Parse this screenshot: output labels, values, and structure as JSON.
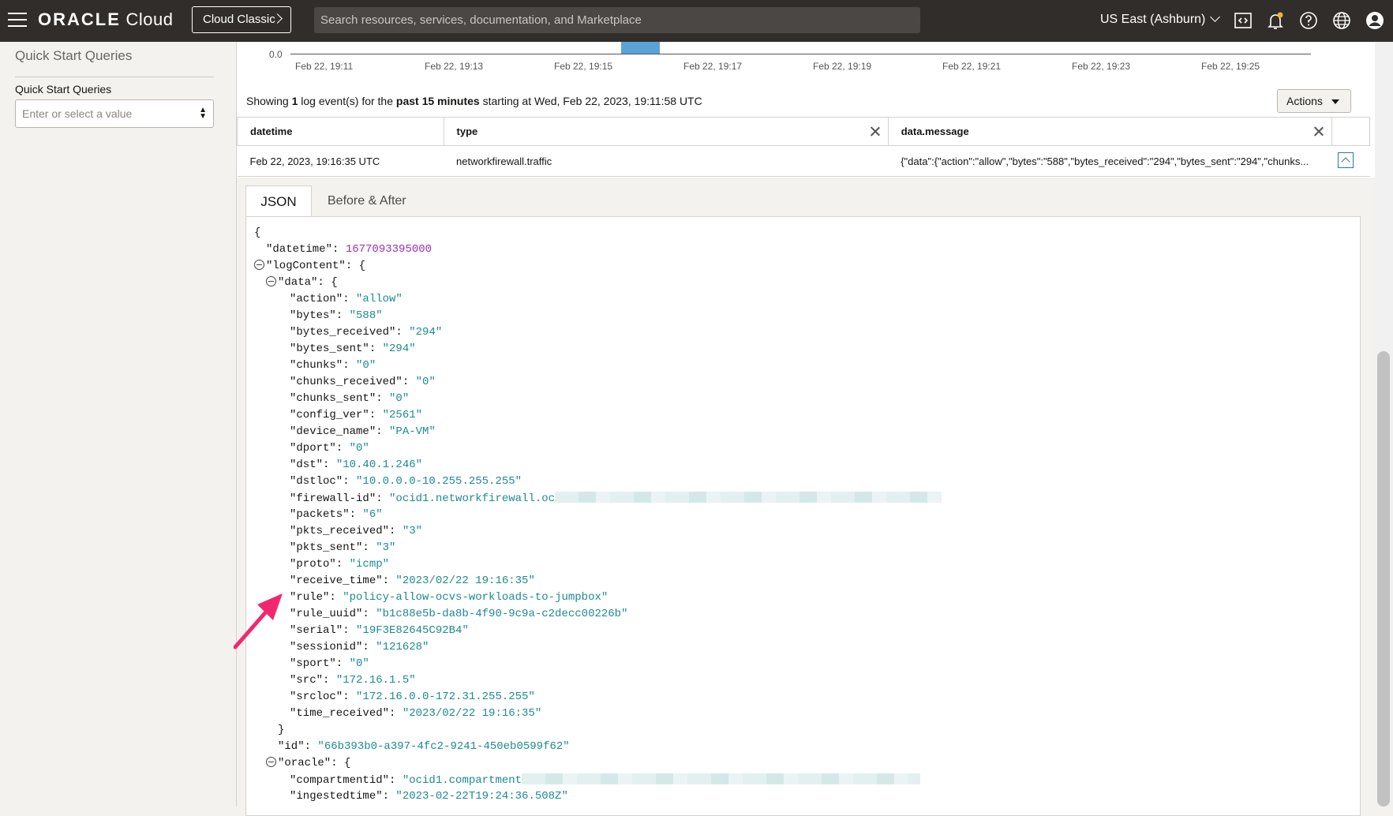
{
  "header": {
    "brand_bold": "ORACLE",
    "brand_light": " Cloud",
    "classic_button": "Cloud Classic",
    "search_placeholder": "Search resources, services, documentation, and Marketplace",
    "region": "US East (Ashburn)",
    "icons": [
      "menu-icon",
      "code-editor-icon",
      "notifications-icon",
      "help-icon",
      "language-icon",
      "profile-icon"
    ]
  },
  "sidebar": {
    "title": "Quick Start Queries",
    "field_label": "Quick Start Queries",
    "field_placeholder": "Enter or select a value"
  },
  "chart": {
    "y_label": "0.0",
    "x_ticks": [
      "Feb 22, 19:11",
      "Feb 22, 19:13",
      "Feb 22, 19:15",
      "Feb 22, 19:17",
      "Feb 22, 19:19",
      "Feb 22, 19:21",
      "Feb 22, 19:23",
      "Feb 22, 19:25"
    ]
  },
  "summary": {
    "prefix": "Showing ",
    "count": "1",
    "middle": " log event(s) for the ",
    "period": "past 15 minutes",
    "suffix": " starting at Wed, Feb 22, 2023, 19:11:58 UTC",
    "actions_label": "Actions"
  },
  "table": {
    "columns": [
      "datetime",
      "type",
      "data.message"
    ],
    "row": {
      "datetime": "Feb 22, 2023, 19:16:35 UTC",
      "type": "networkfirewall.traffic",
      "message": "{\"data\":{\"action\":\"allow\",\"bytes\":\"588\",\"bytes_received\":\"294\",\"bytes_sent\":\"294\",\"chunks..."
    }
  },
  "detail": {
    "tabs": [
      "JSON",
      "Before & After"
    ],
    "json_lines": [
      {
        "indent": 0,
        "key": "{",
        "value": "",
        "type": "brace",
        "toggle": false
      },
      {
        "indent": 1,
        "key": "\"datetime\": ",
        "value": "1677093395000",
        "type": "number",
        "toggle": false
      },
      {
        "indent": 1,
        "key": "\"logContent\": {",
        "value": "",
        "type": "brace",
        "toggle": true
      },
      {
        "indent": 2,
        "key": "\"data\": {",
        "value": "",
        "type": "brace",
        "toggle": true
      },
      {
        "indent": 3,
        "key": "\"action\": ",
        "value": "\"allow\"",
        "type": "string",
        "toggle": false
      },
      {
        "indent": 3,
        "key": "\"bytes\": ",
        "value": "\"588\"",
        "type": "string",
        "toggle": false
      },
      {
        "indent": 3,
        "key": "\"bytes_received\": ",
        "value": "\"294\"",
        "type": "string",
        "toggle": false
      },
      {
        "indent": 3,
        "key": "\"bytes_sent\": ",
        "value": "\"294\"",
        "type": "string",
        "toggle": false
      },
      {
        "indent": 3,
        "key": "\"chunks\": ",
        "value": "\"0\"",
        "type": "string",
        "toggle": false
      },
      {
        "indent": 3,
        "key": "\"chunks_received\": ",
        "value": "\"0\"",
        "type": "string",
        "toggle": false
      },
      {
        "indent": 3,
        "key": "\"chunks_sent\": ",
        "value": "\"0\"",
        "type": "string",
        "toggle": false
      },
      {
        "indent": 3,
        "key": "\"config_ver\": ",
        "value": "\"2561\"",
        "type": "string",
        "toggle": false
      },
      {
        "indent": 3,
        "key": "\"device_name\": ",
        "value": "\"PA-VM\"",
        "type": "string",
        "toggle": false
      },
      {
        "indent": 3,
        "key": "\"dport\": ",
        "value": "\"0\"",
        "type": "string",
        "toggle": false
      },
      {
        "indent": 3,
        "key": "\"dst\": ",
        "value": "\"10.40.1.246\"",
        "type": "string",
        "toggle": false
      },
      {
        "indent": 3,
        "key": "\"dstloc\": ",
        "value": "\"10.0.0.0-10.255.255.255\"",
        "type": "string",
        "toggle": false
      },
      {
        "indent": 3,
        "key": "\"firewall-id\": ",
        "value": "\"ocid1.networkfirewall.oc",
        "type": "string",
        "toggle": false,
        "redacted": true
      },
      {
        "indent": 3,
        "key": "\"packets\": ",
        "value": "\"6\"",
        "type": "string",
        "toggle": false
      },
      {
        "indent": 3,
        "key": "\"pkts_received\": ",
        "value": "\"3\"",
        "type": "string",
        "toggle": false
      },
      {
        "indent": 3,
        "key": "\"pkts_sent\": ",
        "value": "\"3\"",
        "type": "string",
        "toggle": false
      },
      {
        "indent": 3,
        "key": "\"proto\": ",
        "value": "\"icmp\"",
        "type": "string",
        "toggle": false
      },
      {
        "indent": 3,
        "key": "\"receive_time\": ",
        "value": "\"2023/02/22 19:16:35\"",
        "type": "string",
        "toggle": false
      },
      {
        "indent": 3,
        "key": "\"rule\": ",
        "value": "\"policy-allow-ocvs-workloads-to-jumpbox\"",
        "type": "string",
        "toggle": false
      },
      {
        "indent": 3,
        "key": "\"rule_uuid\": ",
        "value": "\"b1c88e5b-da8b-4f90-9c9a-c2decc00226b\"",
        "type": "string",
        "toggle": false
      },
      {
        "indent": 3,
        "key": "\"serial\": ",
        "value": "\"19F3E82645C92B4\"",
        "type": "string",
        "toggle": false
      },
      {
        "indent": 3,
        "key": "\"sessionid\": ",
        "value": "\"121628\"",
        "type": "string",
        "toggle": false
      },
      {
        "indent": 3,
        "key": "\"sport\": ",
        "value": "\"0\"",
        "type": "string",
        "toggle": false
      },
      {
        "indent": 3,
        "key": "\"src\": ",
        "value": "\"172.16.1.5\"",
        "type": "string",
        "toggle": false
      },
      {
        "indent": 3,
        "key": "\"srcloc\": ",
        "value": "\"172.16.0.0-172.31.255.255\"",
        "type": "string",
        "toggle": false
      },
      {
        "indent": 3,
        "key": "\"time_received\": ",
        "value": "\"2023/02/22 19:16:35\"",
        "type": "string",
        "toggle": false
      },
      {
        "indent": 2,
        "key": "}",
        "value": "",
        "type": "brace",
        "toggle": false
      },
      {
        "indent": 2,
        "key": "\"id\": ",
        "value": "\"66b393b0-a397-4fc2-9241-450eb0599f62\"",
        "type": "string",
        "toggle": false
      },
      {
        "indent": 2,
        "key": "\"oracle\": {",
        "value": "",
        "type": "brace",
        "toggle": true
      },
      {
        "indent": 3,
        "key": "\"compartmentid\": ",
        "value": "\"ocid1.compartment",
        "type": "string",
        "toggle": false,
        "redacted": true
      },
      {
        "indent": 3,
        "key": "\"ingestedtime\": ",
        "value": "\"2023-02-22T19:24:36.508Z\"",
        "type": "string",
        "toggle": false
      }
    ]
  },
  "colors": {
    "header_bg": "#312d2a",
    "json_string": "#1d8a91",
    "json_number": "#9b2fb5",
    "annotation_arrow": "#f0296f"
  }
}
